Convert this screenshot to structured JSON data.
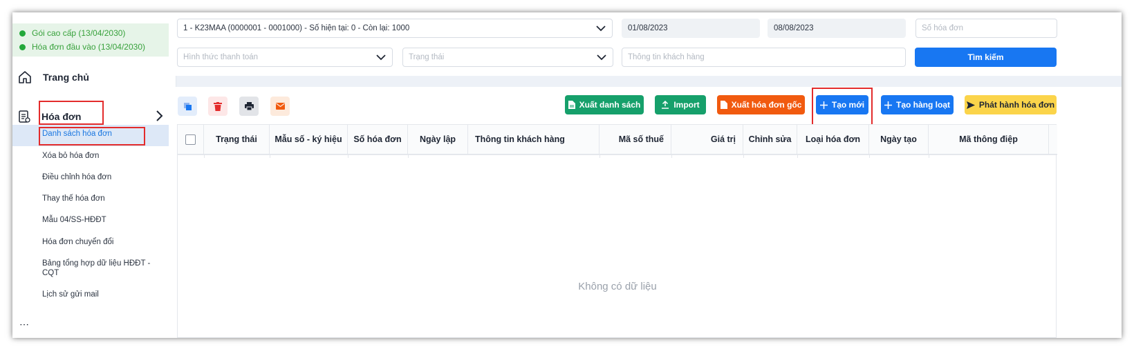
{
  "sidebar": {
    "plans": [
      "Gói cao cấp (13/04/2030)",
      "Hóa đơn đầu vào (13/04/2030)"
    ],
    "home_label": "Trang chủ",
    "invoice_label": "Hóa đơn",
    "sub_items": [
      "Danh sách hóa đơn",
      "Xóa bỏ hóa đơn",
      "Điều chỉnh hóa đơn",
      "Thay thế hóa đơn",
      "Mẫu 04/SS-HĐĐT",
      "Hóa đơn chuyển đổi",
      "Bảng tổng hợp dữ liệu HĐĐT - CQT",
      "Lịch sử gửi mail"
    ]
  },
  "filters": {
    "series_value": "1 - K23MAA (0000001 - 0001000) - Số hiện tại: 0 - Còn lại: 1000",
    "date_from": "01/08/2023",
    "date_to": "08/08/2023",
    "invoice_no_placeholder": "Số hóa đơn",
    "payment_placeholder": "Hình thức thanh toán",
    "status_placeholder": "Trạng thái",
    "customer_placeholder": "Thông tin khách hàng",
    "search_label": "Tìm kiếm"
  },
  "toolbar": {
    "export_list": "Xuất danh sách",
    "import": "Import",
    "export_original": "Xuất hóa đơn gốc",
    "create_new": "Tạo mới",
    "bulk_create": "Tạo hàng loạt",
    "issue": "Phát hành hóa đơn"
  },
  "table": {
    "headers": [
      "Trạng thái",
      "Mẫu số - ký hiệu",
      "Số hóa đơn",
      "Ngày lập",
      "Thông tin khách hàng",
      "Mã số thuế",
      "Giá trị",
      "Chỉnh sửa",
      "Loại hóa đơn",
      "Ngày tạo",
      "Mã thông điệp"
    ],
    "empty_text": "Không có dữ liệu"
  },
  "colors": {
    "primary": "#1877f2",
    "green": "#16a06b",
    "orange": "#f15a0f",
    "yellow": "#fbd44a",
    "highlight": "#e32b2b"
  }
}
